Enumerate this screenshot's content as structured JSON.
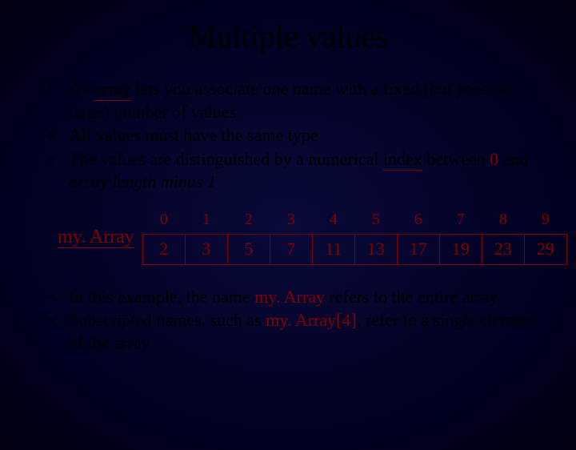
{
  "title": "Multiple values",
  "bullets_top": [
    {
      "pre": "An ",
      "u": "array",
      "post": " lets you associate one name with a fixed (but possibly large) number of values"
    },
    {
      "pre": "All values must have the same type",
      "u": "",
      "post": ""
    },
    {
      "pre": "The values are distinguished by a numerical ",
      "u": "index",
      "post": " between ",
      "code": "0",
      "post2": " and ",
      "ital": "array length minus 1"
    }
  ],
  "array_label": "my. Array",
  "array": {
    "indices": [
      "0",
      "1",
      "2",
      "3",
      "4",
      "5",
      "6",
      "7",
      "8",
      "9"
    ],
    "values": [
      "2",
      "3",
      "5",
      "7",
      "11",
      "13",
      "17",
      "19",
      "23",
      "29"
    ]
  },
  "bullets_bottom": [
    {
      "pre": "In this example, the name ",
      "code": "my. Array",
      "post": " refers to the entire array"
    },
    {
      "pre": "Subscripted names, such as ",
      "code": "my. Array[4]",
      "post": ", refer to a single element of the array"
    }
  ]
}
